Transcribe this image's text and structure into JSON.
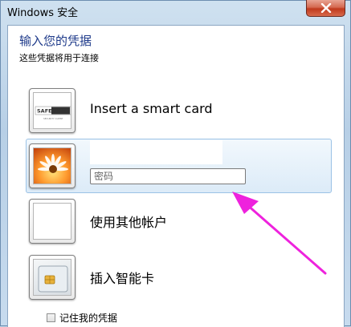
{
  "window": {
    "title": "Windows 安全"
  },
  "dialog": {
    "heading": "输入您的凭据",
    "subheading": "这些凭据将用于连接"
  },
  "options": [
    {
      "label": "Insert a smart card",
      "icon": "safesign-reader-icon",
      "logo_text": "SAFESIGN",
      "logo_small_text": "SECURITY CLIENT"
    },
    {
      "label": "",
      "icon": "flower-avatar-icon",
      "password_placeholder": "密码"
    },
    {
      "label": "使用其他帐户",
      "icon": "blank-account-icon"
    },
    {
      "label": "插入智能卡",
      "icon": "smart-card-icon"
    }
  ],
  "remember": {
    "label": "记住我的凭据",
    "checked": false
  },
  "colors": {
    "heading": "#1e3a8a",
    "annotation_arrow": "#ee22dd",
    "selection": "#dcebf8"
  }
}
